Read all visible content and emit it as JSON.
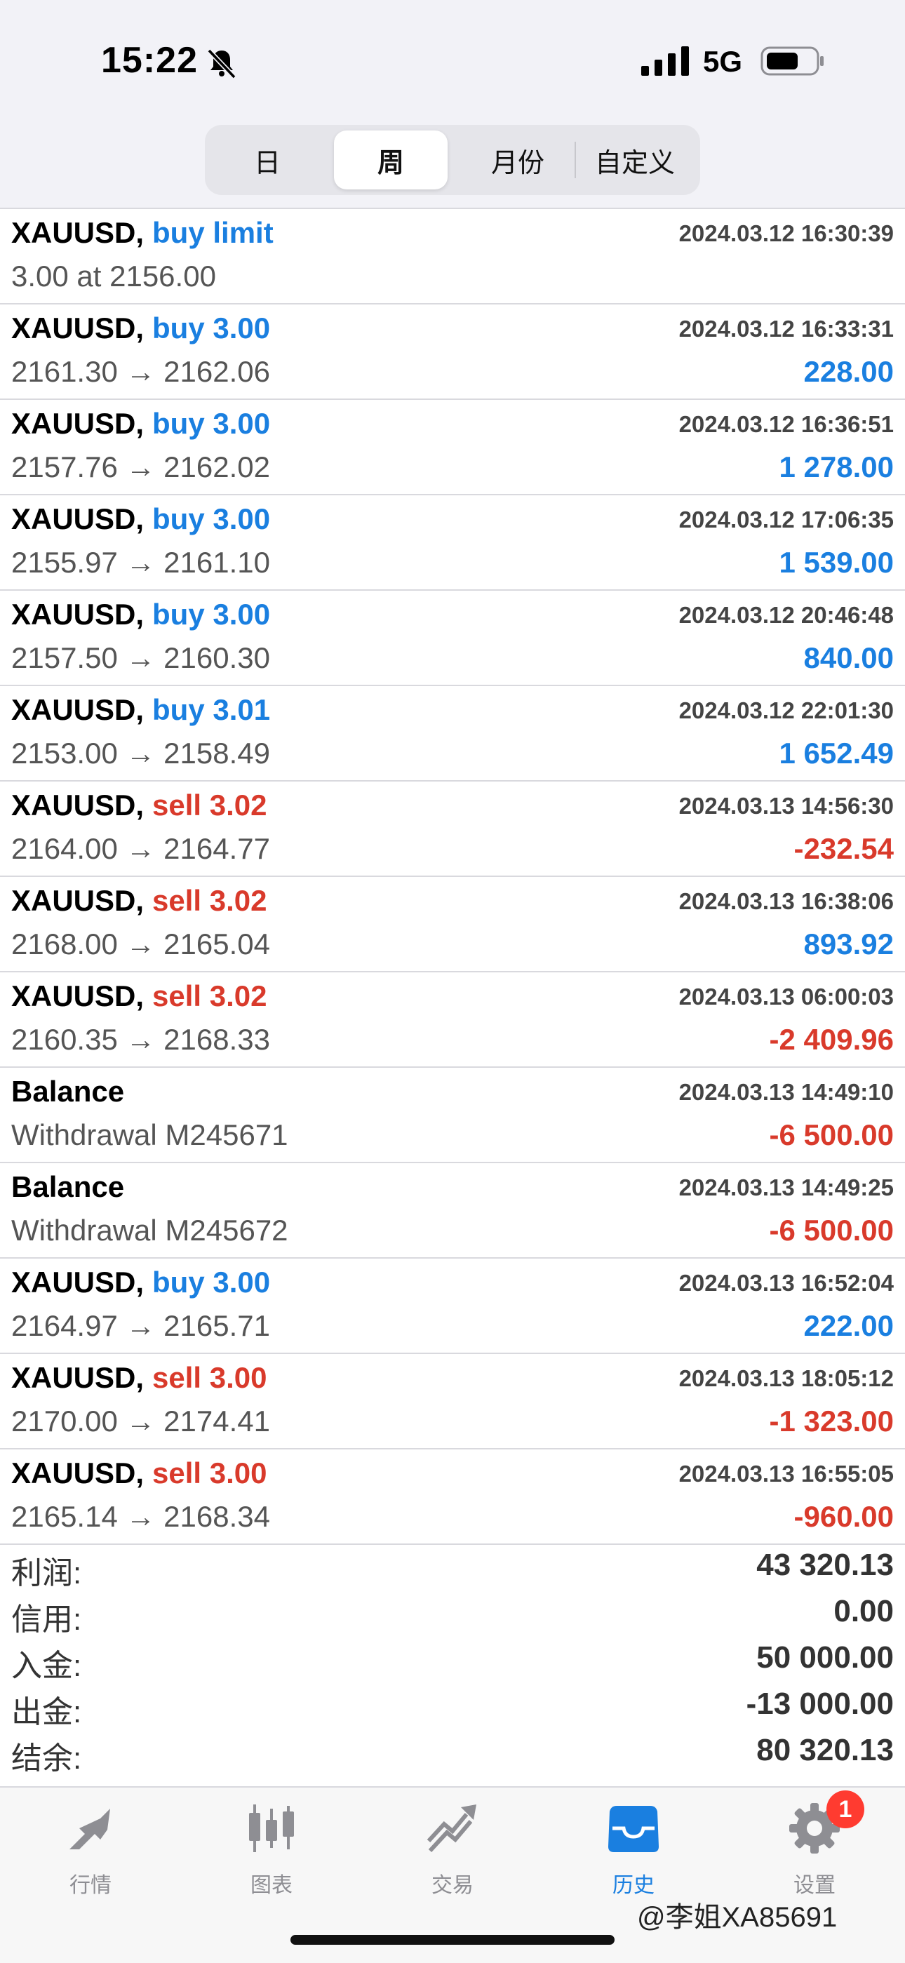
{
  "status_bar": {
    "time": "15:22",
    "network": "5G"
  },
  "segments": [
    {
      "label": "日",
      "selected": false
    },
    {
      "label": "周",
      "selected": true
    },
    {
      "label": "月份",
      "selected": false
    },
    {
      "label": "自定义",
      "selected": false
    }
  ],
  "rows": [
    {
      "symbol": "XAUUSD,",
      "action": "buy limit",
      "side": "buy",
      "time": "2024.03.12 16:30:39",
      "detail": "3.00 at 2156.00",
      "profit": "",
      "sign": ""
    },
    {
      "symbol": "XAUUSD,",
      "action": "buy 3.00",
      "side": "buy",
      "time": "2024.03.12 16:33:31",
      "detail": "2161.30 → 2162.06",
      "profit": "228.00",
      "sign": "pos"
    },
    {
      "symbol": "XAUUSD,",
      "action": "buy 3.00",
      "side": "buy",
      "time": "2024.03.12 16:36:51",
      "detail": "2157.76 → 2162.02",
      "profit": "1 278.00",
      "sign": "pos"
    },
    {
      "symbol": "XAUUSD,",
      "action": "buy 3.00",
      "side": "buy",
      "time": "2024.03.12 17:06:35",
      "detail": "2155.97 → 2161.10",
      "profit": "1 539.00",
      "sign": "pos"
    },
    {
      "symbol": "XAUUSD,",
      "action": "buy 3.00",
      "side": "buy",
      "time": "2024.03.12 20:46:48",
      "detail": "2157.50 → 2160.30",
      "profit": "840.00",
      "sign": "pos"
    },
    {
      "symbol": "XAUUSD,",
      "action": "buy 3.01",
      "side": "buy",
      "time": "2024.03.12 22:01:30",
      "detail": "2153.00 → 2158.49",
      "profit": "1 652.49",
      "sign": "pos"
    },
    {
      "symbol": "XAUUSD,",
      "action": "sell 3.02",
      "side": "sell",
      "time": "2024.03.13 14:56:30",
      "detail": "2164.00 → 2164.77",
      "profit": "-232.54",
      "sign": "neg"
    },
    {
      "symbol": "XAUUSD,",
      "action": "sell 3.02",
      "side": "sell",
      "time": "2024.03.13 16:38:06",
      "detail": "2168.00 → 2165.04",
      "profit": "893.92",
      "sign": "pos"
    },
    {
      "symbol": "XAUUSD,",
      "action": "sell 3.02",
      "side": "sell",
      "time": "2024.03.13 06:00:03",
      "detail": "2160.35 → 2168.33",
      "profit": "-2 409.96",
      "sign": "neg"
    },
    {
      "symbol": "Balance",
      "action": "",
      "side": "",
      "time": "2024.03.13 14:49:10",
      "detail": "Withdrawal M245671",
      "profit": "-6 500.00",
      "sign": "neg"
    },
    {
      "symbol": "Balance",
      "action": "",
      "side": "",
      "time": "2024.03.13 14:49:25",
      "detail": "Withdrawal M245672",
      "profit": "-6 500.00",
      "sign": "neg"
    },
    {
      "symbol": "XAUUSD,",
      "action": "buy 3.00",
      "side": "buy",
      "time": "2024.03.13 16:52:04",
      "detail": "2164.97 → 2165.71",
      "profit": "222.00",
      "sign": "pos"
    },
    {
      "symbol": "XAUUSD,",
      "action": "sell 3.00",
      "side": "sell",
      "time": "2024.03.13 18:05:12",
      "detail": "2170.00 → 2174.41",
      "profit": "-1 323.00",
      "sign": "neg"
    },
    {
      "symbol": "XAUUSD,",
      "action": "sell 3.00",
      "side": "sell",
      "time": "2024.03.13 16:55:05",
      "detail": "2165.14 → 2168.34",
      "profit": "-960.00",
      "sign": "neg"
    }
  ],
  "summary": [
    {
      "label": "利润:",
      "value": "43 320.13"
    },
    {
      "label": "信用:",
      "value": "0.00"
    },
    {
      "label": "入金:",
      "value": "50 000.00"
    },
    {
      "label": "出金:",
      "value": "-13 000.00"
    },
    {
      "label": "结余:",
      "value": "80 320.13"
    }
  ],
  "tabs": [
    {
      "name": "quotes",
      "label": "行情",
      "icon": "quotes-arrow-icon",
      "active": false
    },
    {
      "name": "charts",
      "label": "图表",
      "icon": "candlestick-icon",
      "active": false
    },
    {
      "name": "trade",
      "label": "交易",
      "icon": "trade-trend-icon",
      "active": false
    },
    {
      "name": "history",
      "label": "历史",
      "icon": "inbox-icon",
      "active": true
    },
    {
      "name": "settings",
      "label": "设置",
      "icon": "gear-icon",
      "active": false
    }
  ],
  "settings_badge": "1",
  "watermark": "@李姐XA85691",
  "colors": {
    "buy": "#1a7fe0",
    "sell": "#d93a2b",
    "badge": "#ff3b30"
  }
}
